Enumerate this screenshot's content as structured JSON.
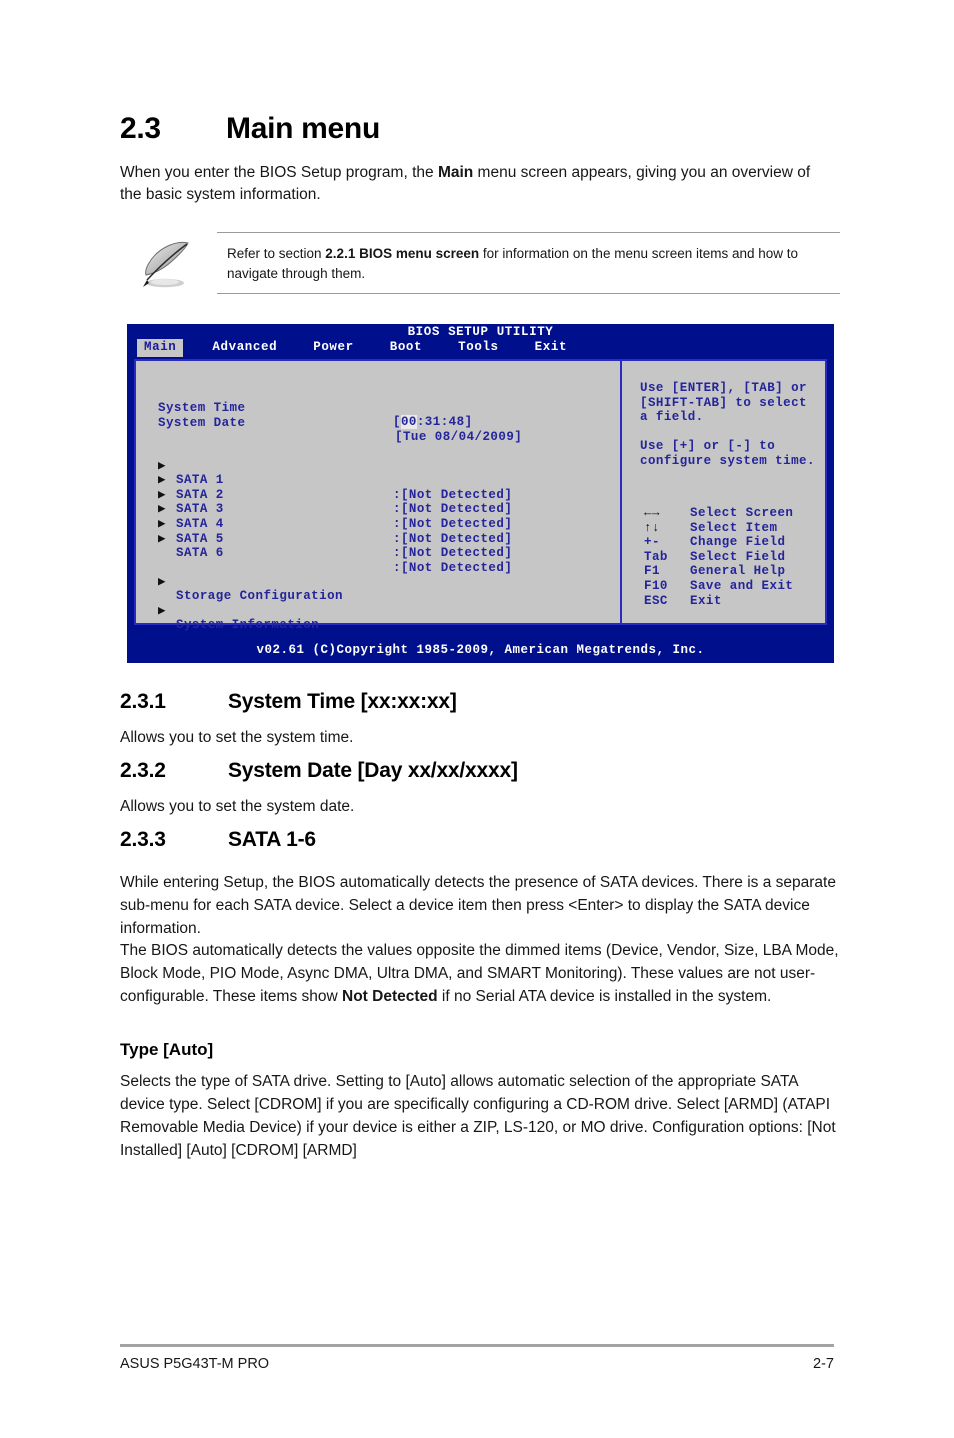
{
  "section": {
    "number": "2.3",
    "title": "Main menu",
    "intro_before": "When you enter the BIOS Setup program, the ",
    "intro_bold": "Main",
    "intro_after": " menu screen appears, giving you an overview of the basic system information."
  },
  "note": {
    "icon": "quill-pen-icon",
    "text_before": "Refer to section ",
    "text_bold": "2.2.1 BIOS menu screen",
    "text_after": " for information on the menu screen items and how to navigate through them."
  },
  "bios": {
    "title": "BIOS SETUP UTILITY",
    "tabs": [
      {
        "label": "Main",
        "active": true
      },
      {
        "label": "Advanced",
        "active": false
      },
      {
        "label": "Power",
        "active": false
      },
      {
        "label": "Boot",
        "active": false
      },
      {
        "label": "Tools",
        "active": false
      },
      {
        "label": "Exit",
        "active": false
      }
    ],
    "fields": [
      {
        "label": "System Time",
        "value_prefix": "[",
        "value_highlight": "00",
        "value_rest": ":31:48]"
      },
      {
        "label": "System Date",
        "value_prefix": "[",
        "value_highlight": "",
        "value_rest": "Tue 08/04/2009]"
      }
    ],
    "sata_items": [
      {
        "name": "SATA 1",
        "value": ":[Not Detected]"
      },
      {
        "name": "SATA 2",
        "value": ":[Not Detected]"
      },
      {
        "name": "SATA 3",
        "value": ":[Not Detected]"
      },
      {
        "name": "SATA 4",
        "value": ":[Not Detected]"
      },
      {
        "name": "SATA 5",
        "value": ":[Not Detected]"
      },
      {
        "name": "SATA 6",
        "value": ":[Not Detected]"
      }
    ],
    "submenus": [
      {
        "name": "Storage Configuration"
      },
      {
        "name": "System Information"
      }
    ],
    "help_lines": [
      "Use [ENTER], [TAB] or",
      "[SHIFT-TAB] to select",
      "a field.",
      "",
      "Use [+] or [-] to",
      "configure system time."
    ],
    "legend": [
      {
        "glyph": "←→",
        "key": "",
        "desc": "Select Screen"
      },
      {
        "glyph": "↑↓",
        "key": "",
        "desc": "Select Item"
      },
      {
        "glyph": "",
        "key": "+-",
        "desc": "Change Field"
      },
      {
        "glyph": "",
        "key": "Tab",
        "desc": "Select Field"
      },
      {
        "glyph": "",
        "key": "F1",
        "desc": "General Help"
      },
      {
        "glyph": "",
        "key": "F10",
        "desc": "Save and Exit"
      },
      {
        "glyph": "",
        "key": "ESC",
        "desc": "Exit"
      }
    ],
    "footer": "v02.61 (C)Copyright 1985-2009, American Megatrends, Inc.",
    "colors": {
      "chrome": "#000f8c",
      "panel": "#c6c6c6",
      "panel_border": "#2b2bc2",
      "text_blue": "#24249b",
      "active_tab_bg": "#c6c6c6"
    }
  },
  "subsections": [
    {
      "number": "2.3.1",
      "title": "System Time [xx:xx:xx]",
      "body": "Allows you to set the system time."
    },
    {
      "number": "2.3.2",
      "title": "System Date [Day xx/xx/xxxx]",
      "body": "Allows you to set the system date."
    },
    {
      "number": "2.3.3",
      "title": "SATA 1-6",
      "para1": "While entering Setup, the BIOS automatically detects the presence of SATA devices. There is a separate sub-menu for each SATA device. Select a device item then press <Enter> to display the SATA device information.",
      "para2_before": "The BIOS automatically detects the values opposite the dimmed items (Device, Vendor, Size, LBA Mode, Block Mode, PIO Mode, Async DMA, Ultra DMA, and SMART Monitoring). These values are not user-configurable. These items show ",
      "para2_bold": "Not Detected",
      "para2_after": " if no Serial ATA device is installed in the system."
    }
  ],
  "type_block": {
    "heading": "Type [Auto]",
    "body": "Selects the type of SATA drive. Setting to [Auto] allows automatic selection of the appropriate SATA device type. Select [CDROM] if you are specifically configuring a CD-ROM drive. Select [ARMD] (ATAPI Removable Media Device) if your device is either a ZIP, LS-120, or MO drive. Configuration options: [Not Installed] [Auto] [CDROM] [ARMD]"
  },
  "footer": {
    "left": "ASUS P5G43T-M PRO",
    "right": "2-7"
  }
}
